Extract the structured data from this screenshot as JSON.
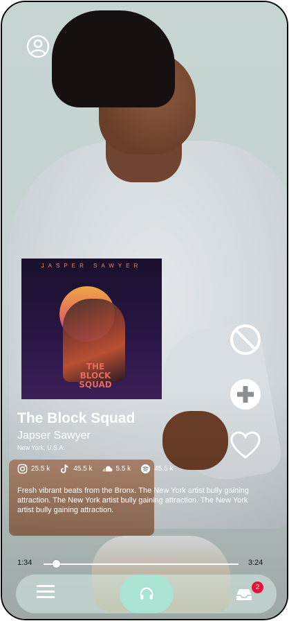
{
  "album": {
    "cover_artist_text": "JASPER SAWYER",
    "cover_title_text": "THE BLOCK SQUAD"
  },
  "track": {
    "title": "The Block Squad",
    "artist": "Japser Sawyer",
    "location": "New York, U.S.A."
  },
  "stats": [
    {
      "platform": "instagram",
      "icon": "instagram-icon",
      "count": "25.5 k"
    },
    {
      "platform": "tiktok",
      "icon": "tiktok-icon",
      "count": "45.5 k"
    },
    {
      "platform": "soundcloud",
      "icon": "soundcloud-icon",
      "count": "5.5 k"
    },
    {
      "platform": "spotify",
      "icon": "spotify-icon",
      "count": "45.5 k"
    }
  ],
  "description": "Fresh vibrant beats from the Bronx. The New York artist bully gaining attraction. The New York artist bully gaining attraction. The New York artist bully gaining attraction.",
  "player": {
    "current_time": "1:34",
    "total_time": "3:24",
    "progress_fraction": 0.065
  },
  "actions": {
    "block_icon": "block-icon",
    "add_icon": "plus-circle-icon",
    "like_icon": "heart-icon"
  },
  "nav": {
    "menu_icon": "hamburger-menu-icon",
    "listen_icon": "headphones-icon",
    "inbox_icon": "inbox-icon",
    "inbox_badge": "2",
    "active_color": "#a8e3d4",
    "badge_color": "#e2143a"
  }
}
